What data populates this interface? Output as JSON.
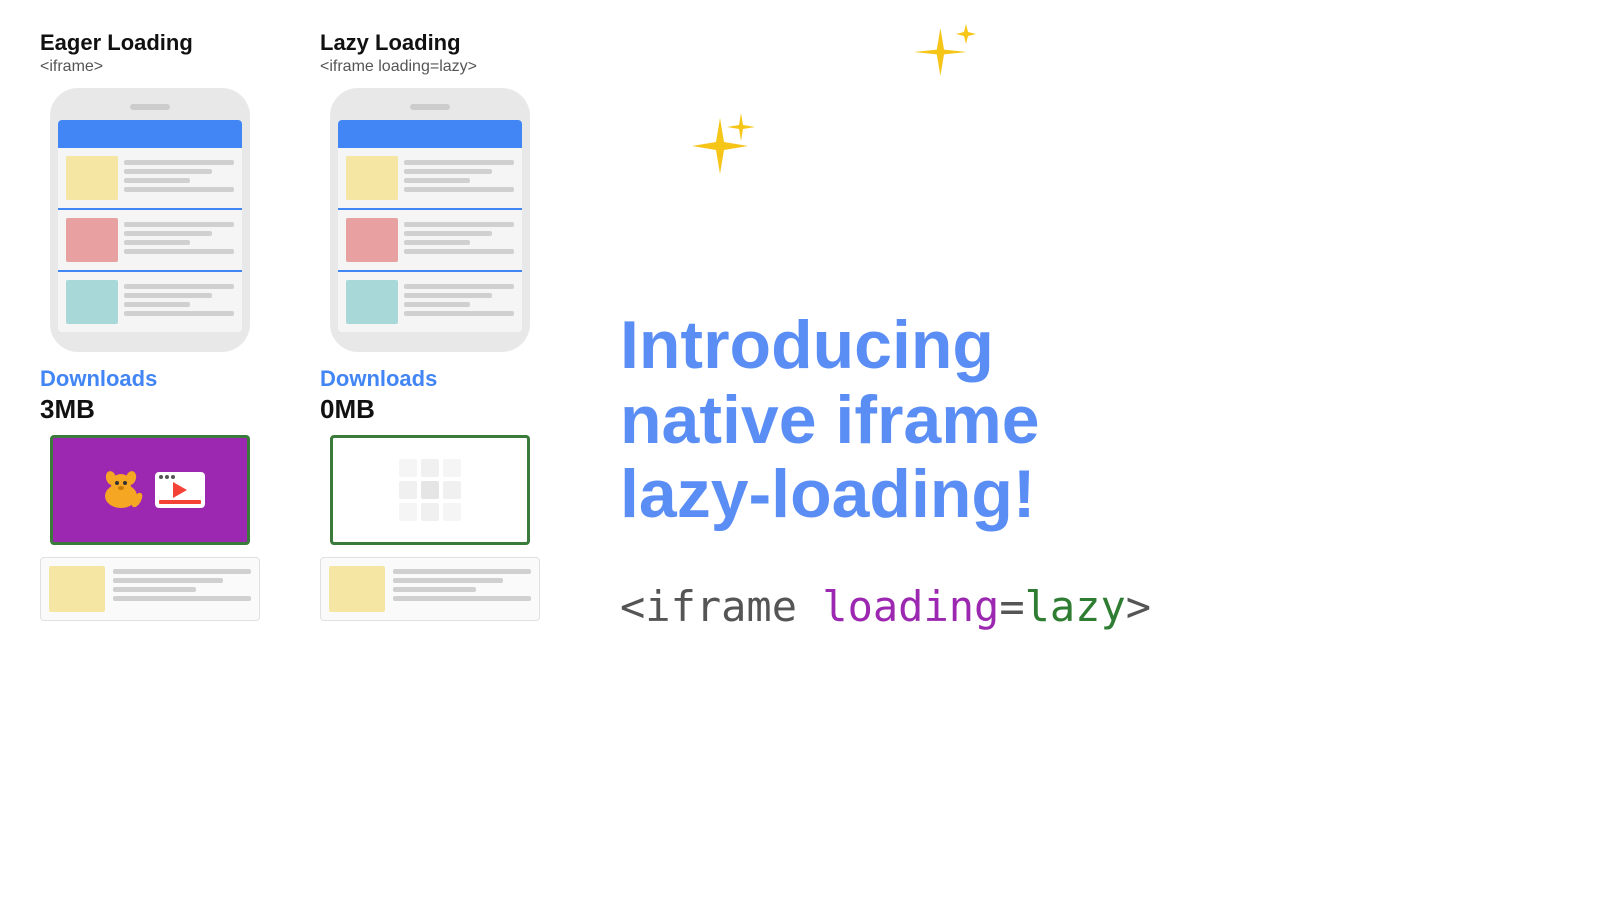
{
  "eager": {
    "title": "Eager Loading",
    "subtitle": "<iframe>",
    "downloads_label": "Downloads",
    "downloads_size": "3MB"
  },
  "lazy": {
    "title": "Lazy Loading",
    "subtitle": "<iframe loading=lazy>",
    "downloads_label": "Downloads",
    "downloads_size": "0MB"
  },
  "headline": {
    "line1": "Introducing",
    "line2": "native iframe",
    "line3": "lazy-loading!"
  },
  "code": {
    "prefix": "<iframe ",
    "attr": "loading=lazy",
    "suffix": ">"
  },
  "sparkle": "✦"
}
